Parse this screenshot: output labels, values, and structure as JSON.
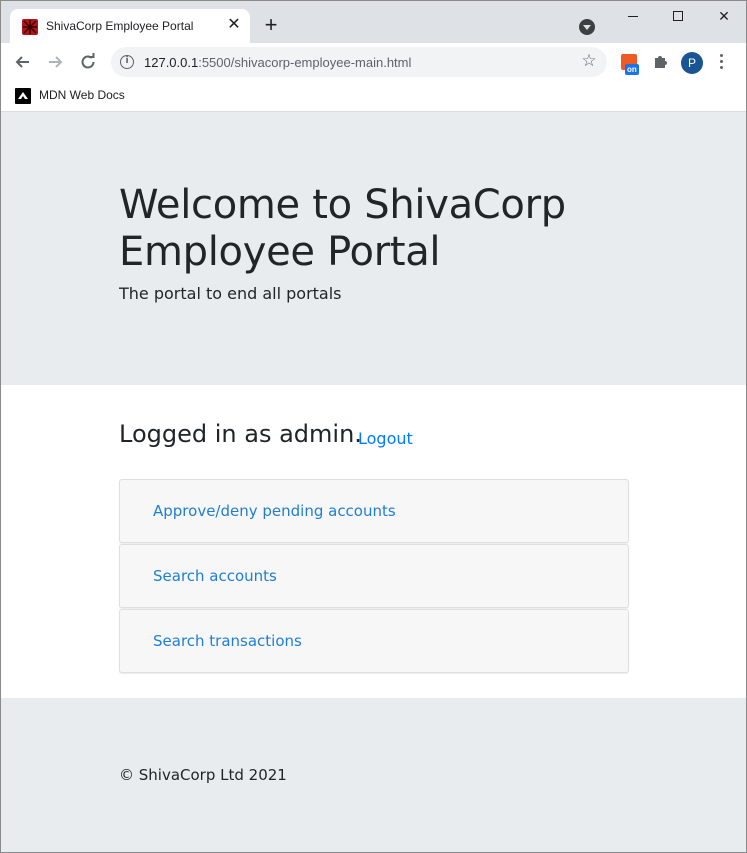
{
  "browser": {
    "tab_title": "ShivaCorp Employee Portal",
    "url_host": "127.0.0.1",
    "url_rest": ":5500/shivacorp-employee-main.html",
    "profile_initial": "P",
    "extension_badge": "on",
    "bookmarks": [
      {
        "label": "MDN Web Docs",
        "icon": "mdn-icon"
      }
    ],
    "colors": {
      "tabstrip": "#dee1e6",
      "avatar": "#1a5493",
      "extension": "#f05a24"
    }
  },
  "page": {
    "hero": {
      "title": "Welcome to ShivaCorp Employee Portal",
      "subtitle": "The portal to end all portals"
    },
    "session": {
      "status_text": "Logged in as admin.",
      "logout_label": "Logout"
    },
    "actions": [
      {
        "label": "Approve/deny pending accounts"
      },
      {
        "label": "Search accounts"
      },
      {
        "label": "Search transactions"
      }
    ],
    "footer": {
      "copyright": "© ShivaCorp Ltd 2021"
    },
    "colors": {
      "hero_bg": "#e9ecef",
      "link": "#007bff",
      "list_bg": "#f7f7f7"
    }
  }
}
